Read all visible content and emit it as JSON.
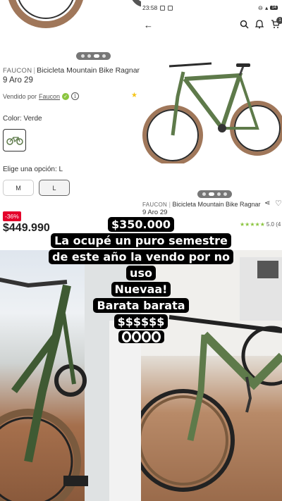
{
  "left_top": {
    "brand": "FAUCON",
    "product_title_line1": "Bicicleta Mountain Bike Ragnar",
    "product_title_line2": "9 Aro 29",
    "sold_by_prefix": "Vendido por",
    "seller": "Faucon",
    "color_label": "Color: Verde",
    "option_label": "Elige una opción: L",
    "sizes": [
      "M",
      "L"
    ],
    "selected_size": "L",
    "discount": "-36%",
    "price": "$449.990"
  },
  "right_top": {
    "status": {
      "time": "23:58",
      "battery": "14"
    },
    "cart_count": "1",
    "brand": "FAUCON",
    "product_title_line1": "Bicicleta Mountain Bike Ragnar",
    "product_title_line2": "9 Aro 29",
    "seller": "Faucon",
    "rating": "5.0 (4"
  },
  "overlay": {
    "lines": [
      "$350.000",
      "La ocupé un puro semestre",
      "de este año la vendo por no",
      "uso",
      "Nuevaa!",
      "Barata barata",
      "$$$$$$"
    ]
  },
  "colors": {
    "bike_green": "#5e7a4a",
    "discount_red": "#e4002b",
    "verified_green": "#8bc53f",
    "tire_brown": "#a0775a"
  }
}
